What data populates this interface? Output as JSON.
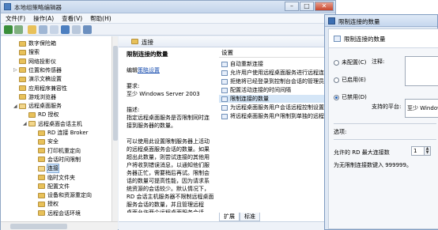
{
  "window": {
    "title": "本地组策略编辑器",
    "controls": {
      "minimize": "–",
      "maximize": "□",
      "close": "✕"
    }
  },
  "menu": [
    "文件(F)",
    "操作(A)",
    "查看(V)",
    "帮助(H)"
  ],
  "tree": [
    {
      "label": "数字保险箱",
      "indent": 1,
      "arrow": "",
      "open": false,
      "selected": false
    },
    {
      "label": "搜索",
      "indent": 1,
      "arrow": "",
      "open": false,
      "selected": false
    },
    {
      "label": "网络投影仪",
      "indent": 1,
      "arrow": "",
      "open": false,
      "selected": false
    },
    {
      "label": "位置和传感器",
      "indent": 1,
      "arrow": "▷",
      "open": false,
      "selected": false
    },
    {
      "label": "演示文稿设置",
      "indent": 1,
      "arrow": "",
      "open": false,
      "selected": false
    },
    {
      "label": "应用程序兼容性",
      "indent": 1,
      "arrow": "",
      "open": false,
      "selected": false
    },
    {
      "label": "游戏浏览器",
      "indent": 1,
      "arrow": "",
      "open": false,
      "selected": false
    },
    {
      "label": "远程桌面服务",
      "indent": 1,
      "arrow": "◢",
      "open": true,
      "selected": false
    },
    {
      "label": "RD 授权",
      "indent": 2,
      "arrow": "",
      "open": false,
      "selected": false
    },
    {
      "label": "远程桌面会话主机",
      "indent": 2,
      "arrow": "◢",
      "open": true,
      "selected": false
    },
    {
      "label": "RD 连接 Broker",
      "indent": 3,
      "arrow": "",
      "open": false,
      "selected": false
    },
    {
      "label": "安全",
      "indent": 3,
      "arrow": "",
      "open": false,
      "selected": false
    },
    {
      "label": "打印机重定向",
      "indent": 3,
      "arrow": "",
      "open": false,
      "selected": false
    },
    {
      "label": "会话时间限制",
      "indent": 3,
      "arrow": "",
      "open": false,
      "selected": false
    },
    {
      "label": "连接",
      "indent": 3,
      "arrow": "",
      "open": true,
      "selected": true
    },
    {
      "label": "临时文件夹",
      "indent": 3,
      "arrow": "",
      "open": false,
      "selected": false
    },
    {
      "label": "配置文件",
      "indent": 3,
      "arrow": "",
      "open": false,
      "selected": false
    },
    {
      "label": "设备和资源重定向",
      "indent": 3,
      "arrow": "",
      "open": false,
      "selected": false
    },
    {
      "label": "授权",
      "indent": 3,
      "arrow": "",
      "open": false,
      "selected": false
    },
    {
      "label": "远程会话环境",
      "indent": 3,
      "arrow": "",
      "open": false,
      "selected": false
    }
  ],
  "pane": {
    "header": "连接",
    "desc_title": "限制连接的数量",
    "edit_prefix": "编辑",
    "edit_link": "策略设置",
    "req_label": "要求:",
    "req_value": "至少 Windows Server 2003",
    "desc_label": "描述:",
    "desc_lines": [
      "指定远程桌面服务是否限制同时连",
      "接到服务器的数量。",
      "",
      "可以使用此设置限制服务器上活动",
      "的远程桌面服务会话的数量。如果",
      "超出此数量，则尝试连接的其他用",
      "户将收到错误消息，以通知他们服",
      "务器正忙，需要稍后再试。限制会",
      "话的数量可提高性能，因为请求系",
      "统资源的会话较少。默认情况下，",
      "RD 会话主机服务器不限制远程桌面",
      "服务会话的数量，并且管理远程",
      "桌面允许两个远程桌面服务会话。"
    ]
  },
  "settings": {
    "column": "设置",
    "items": [
      {
        "label": "自动重新连接",
        "selected": false
      },
      {
        "label": "允许用户使用远程桌面服务进行远程连接",
        "selected": false
      },
      {
        "label": "拒绝将已经登录到控制台会话的管理员注销",
        "selected": false
      },
      {
        "label": "配置活动连接的时间间隔",
        "selected": false
      },
      {
        "label": "限制连接的数量",
        "selected": true
      },
      {
        "label": "为远程桌面服务用户会话远程控制设置规则",
        "selected": false
      },
      {
        "label": "将远程桌面服务用户限制到单独的远程桌面",
        "selected": false
      }
    ]
  },
  "tabs": [
    "扩展",
    "标准"
  ],
  "dialog": {
    "title": "限制连接的数量",
    "header": "限制连接的数量",
    "radios": [
      {
        "label": "未配置(C)",
        "checked": false
      },
      {
        "label": "已启用(E)",
        "checked": false
      },
      {
        "label": "已禁用(D)",
        "checked": true
      }
    ],
    "comment_label": "注释:",
    "platform_label": "支持的平台:",
    "platform_value": "至少 Windows",
    "options_label": "选项:",
    "max_label": "允许的 RD 最大连接数",
    "max_value": "1",
    "hint": "为无限制连接数键入 999999。"
  }
}
